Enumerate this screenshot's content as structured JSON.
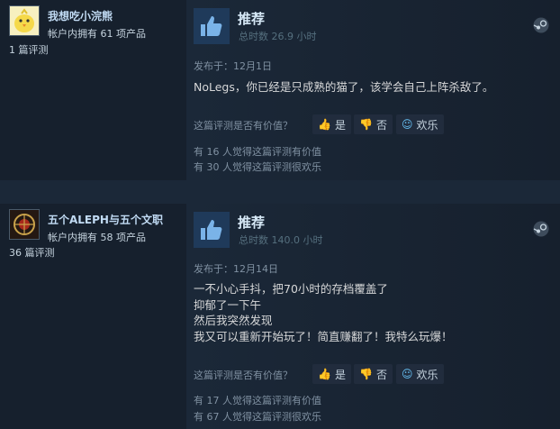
{
  "reviews": [
    {
      "persona": "我想吃小浣熊",
      "owned": "帐户内拥有 61 项产品",
      "num_reviews": "1 篇评测",
      "verdict": "推荐",
      "hours": "总时数 26.9 小时",
      "posted": "发布于：12月1日",
      "lines": [
        "NoLegs，你已经是只成熟的猫了，该学会自己上阵杀敌了。"
      ],
      "helpful_q": "这篇评测是否有价值？",
      "yes": "是",
      "no": "否",
      "funny": "欢乐",
      "stat_helpful": "有 16 人觉得这篇评测有价值",
      "stat_funny": "有 30 人觉得这篇评测很欢乐"
    },
    {
      "persona": "五个ALEPH与五个文职",
      "owned": "帐户内拥有 58 项产品",
      "num_reviews": "36 篇评测",
      "verdict": "推荐",
      "hours": "总时数 140.0 小时",
      "posted": "发布于：12月14日",
      "lines": [
        "一不小心手抖，把70小时的存档覆盖了",
        "抑郁了一下午",
        "然后我突然发现",
        "我又可以重新开始玩了！简直赚翻了！我特么玩爆！"
      ],
      "helpful_q": "这篇评测是否有价值？",
      "yes": "是",
      "no": "否",
      "funny": "欢乐",
      "stat_helpful": "有 17 人觉得这篇评测有价值",
      "stat_funny": "有 67 人觉得这篇评测很欢乐"
    }
  ]
}
